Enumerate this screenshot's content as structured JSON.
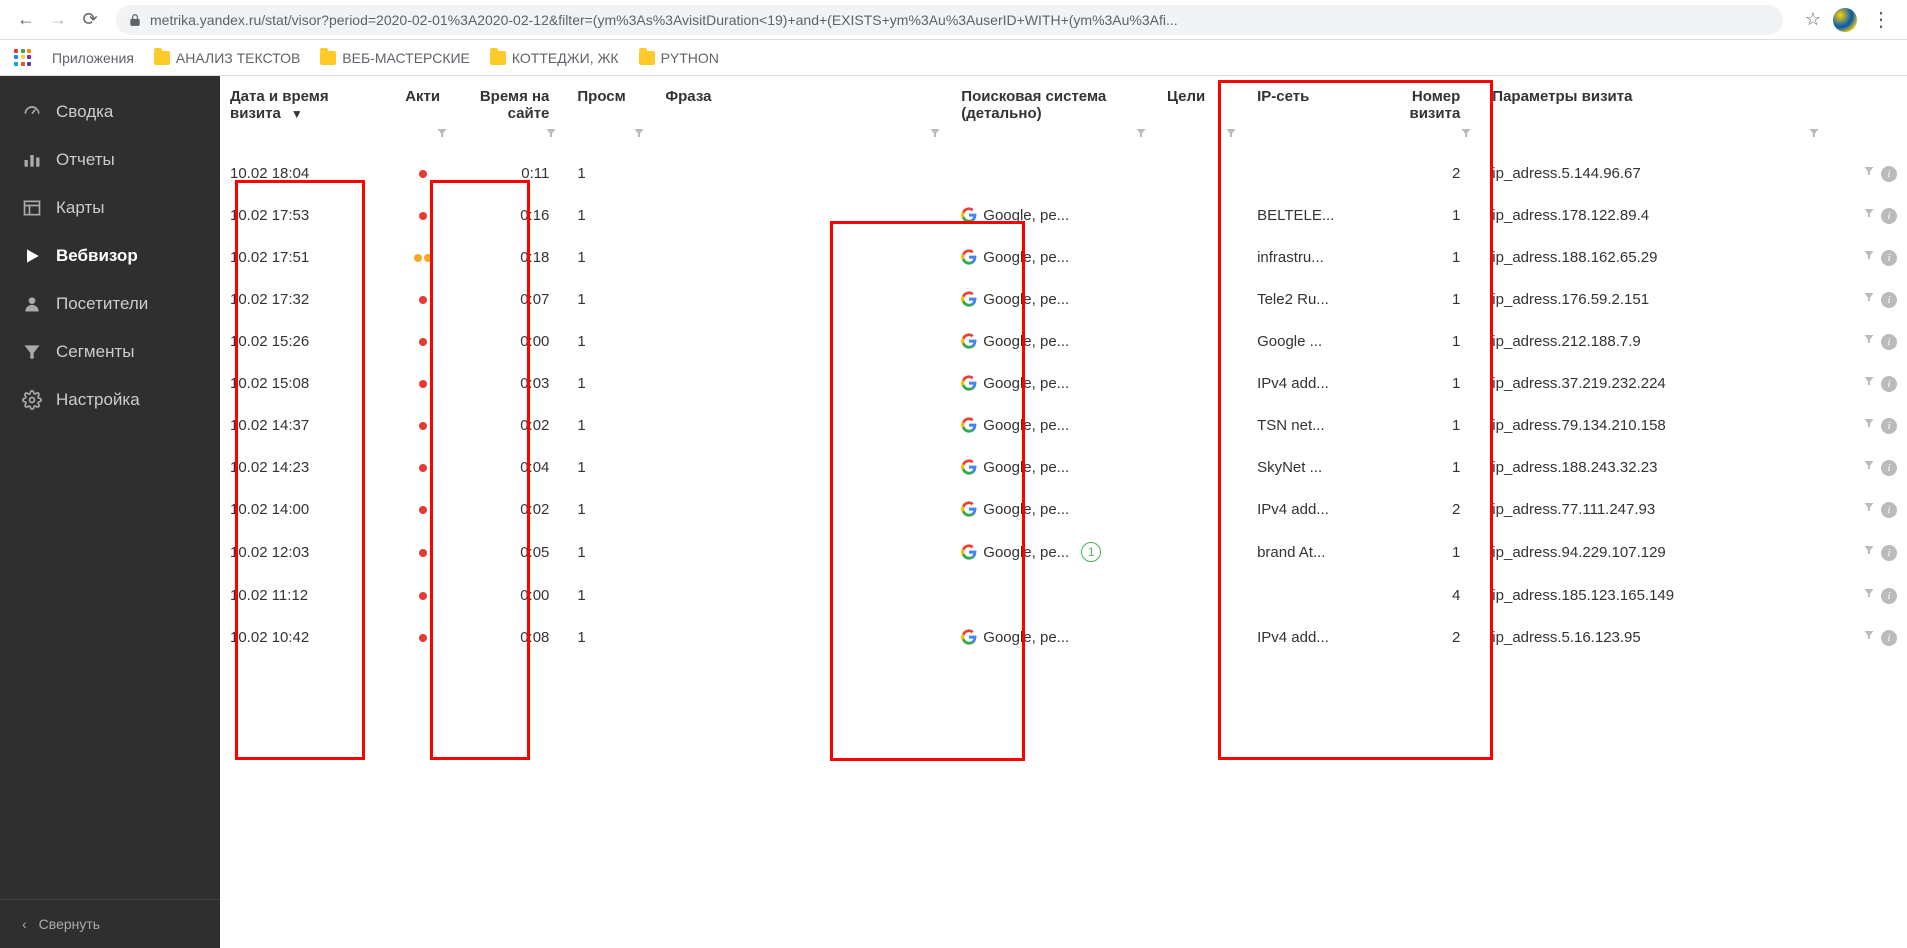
{
  "chrome": {
    "url": "metrika.yandex.ru/stat/visor?period=2020-02-01%3A2020-02-12&filter=(ym%3As%3AvisitDuration<19)+and+(EXISTS+ym%3Au%3AuserID+WITH+(ym%3Au%3Afi...",
    "apps_label": "Приложения"
  },
  "bookmarks": [
    {
      "label": "АНАЛИЗ ТЕКСТОВ"
    },
    {
      "label": "ВЕБ-МАСТЕРСКИЕ"
    },
    {
      "label": "КОТТЕДЖИ, ЖК"
    },
    {
      "label": "PYTHON"
    }
  ],
  "sidebar": {
    "items": [
      {
        "label": "Сводка"
      },
      {
        "label": "Отчеты"
      },
      {
        "label": "Карты"
      },
      {
        "label": "Вебвизор"
      },
      {
        "label": "Посетители"
      },
      {
        "label": "Сегменты"
      },
      {
        "label": "Настройка"
      }
    ],
    "collapse": "Свернуть"
  },
  "table": {
    "headers": {
      "datetime": "Дата и время визита",
      "activity": "Акти",
      "duration": "Время на сайте",
      "views": "Просм",
      "phrase": "Фраза",
      "search": "Поисковая система (детально)",
      "goals": "Цели",
      "ipnet": "IP-сеть",
      "visit_num": "Номер визита",
      "params": "Параметры визита"
    },
    "rows": [
      {
        "dt": "10.02 18:04",
        "act": "r",
        "dur": "0:11",
        "v": "1",
        "se": "",
        "ip": "",
        "num": "2",
        "param": "ip_adress.5.144.96.67"
      },
      {
        "dt": "10.02 17:53",
        "act": "r",
        "dur": "0:16",
        "v": "1",
        "se": "Google, ре...",
        "ip": "BELTELE...",
        "num": "1",
        "param": "ip_adress.178.122.89.4"
      },
      {
        "dt": "10.02 17:51",
        "act": "oo",
        "dur": "0:18",
        "v": "1",
        "se": "Google, ре...",
        "ip": "infrastru...",
        "num": "1",
        "param": "ip_adress.188.162.65.29"
      },
      {
        "dt": "10.02 17:32",
        "act": "r",
        "dur": "0:07",
        "v": "1",
        "se": "Google, ре...",
        "ip": "Tele2 Ru...",
        "num": "1",
        "param": "ip_adress.176.59.2.151"
      },
      {
        "dt": "10.02 15:26",
        "act": "r",
        "dur": "0:00",
        "v": "1",
        "se": "Google, ре...",
        "ip": "Google ...",
        "num": "1",
        "param": "ip_adress.212.188.7.9"
      },
      {
        "dt": "10.02 15:08",
        "act": "r",
        "dur": "0:03",
        "v": "1",
        "se": "Google, ре...",
        "ip": "IPv4 add...",
        "num": "1",
        "param": "ip_adress.37.219.232.224"
      },
      {
        "dt": "10.02 14:37",
        "act": "r",
        "dur": "0:02",
        "v": "1",
        "se": "Google, ре...",
        "ip": "TSN net...",
        "num": "1",
        "param": "ip_adress.79.134.210.158"
      },
      {
        "dt": "10.02 14:23",
        "act": "r",
        "dur": "0:04",
        "v": "1",
        "se": "Google, ре...",
        "ip": "SkyNet ...",
        "num": "1",
        "param": "ip_adress.188.243.32.23"
      },
      {
        "dt": "10.02 14:00",
        "act": "r",
        "dur": "0:02",
        "v": "1",
        "se": "Google, ре...",
        "ip": "IPv4 add...",
        "num": "2",
        "param": "ip_adress.77.111.247.93"
      },
      {
        "dt": "10.02 12:03",
        "act": "r",
        "dur": "0:05",
        "v": "1",
        "se": "Google, ре...",
        "badge": "1",
        "ip": "brand At...",
        "num": "1",
        "param": "ip_adress.94.229.107.129"
      },
      {
        "dt": "10.02 11:12",
        "act": "r",
        "dur": "0:00",
        "v": "1",
        "se": "",
        "ip": "",
        "num": "4",
        "param": "ip_adress.185.123.165.149"
      },
      {
        "dt": "10.02 10:42",
        "act": "r",
        "dur": "0:08",
        "v": "1",
        "se": "Google, ре...",
        "ip": "IPv4 add...",
        "num": "2",
        "param": "ip_adress.5.16.123.95"
      }
    ]
  }
}
